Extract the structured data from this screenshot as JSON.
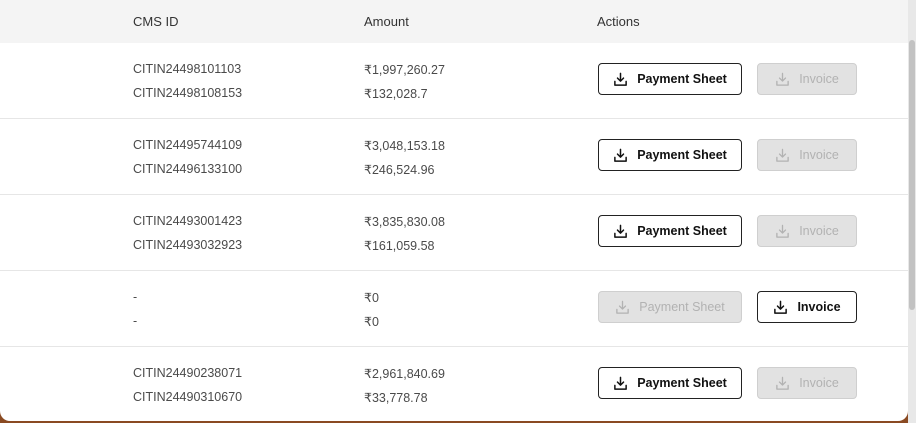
{
  "table": {
    "headers": {
      "cms_id": "CMS ID",
      "amount": "Amount",
      "actions": "Actions"
    },
    "rows": [
      {
        "cms_ids": [
          "CITIN24498101103",
          "CITIN24498108153"
        ],
        "amounts": [
          "₹1,997,260.27",
          "₹132,028.7"
        ],
        "payment_sheet_label": "Payment Sheet",
        "payment_sheet_enabled": true,
        "invoice_label": "Invoice",
        "invoice_enabled": false
      },
      {
        "cms_ids": [
          "CITIN24495744109",
          "CITIN24496133100"
        ],
        "amounts": [
          "₹3,048,153.18",
          "₹246,524.96"
        ],
        "payment_sheet_label": "Payment Sheet",
        "payment_sheet_enabled": true,
        "invoice_label": "Invoice",
        "invoice_enabled": false
      },
      {
        "cms_ids": [
          "CITIN24493001423",
          "CITIN24493032923"
        ],
        "amounts": [
          "₹3,835,830.08",
          "₹161,059.58"
        ],
        "payment_sheet_label": "Payment Sheet",
        "payment_sheet_enabled": true,
        "invoice_label": "Invoice",
        "invoice_enabled": false
      },
      {
        "cms_ids": [
          "-",
          "-"
        ],
        "amounts": [
          "₹0",
          "₹0"
        ],
        "payment_sheet_label": "Payment Sheet",
        "payment_sheet_enabled": false,
        "invoice_label": "Invoice",
        "invoice_enabled": true
      },
      {
        "cms_ids": [
          "CITIN24490238071",
          "CITIN24490310670"
        ],
        "amounts": [
          "₹2,961,840.69",
          "₹33,778.78"
        ],
        "payment_sheet_label": "Payment Sheet",
        "payment_sheet_enabled": true,
        "invoice_label": "Invoice",
        "invoice_enabled": false
      }
    ]
  },
  "icons": {
    "download": "download-tray-icon"
  },
  "colors": {
    "enabled_border": "#222222",
    "disabled_bg": "#e2e2e2",
    "disabled_text": "#b2b2b2",
    "header_bg": "#f4f4f4"
  }
}
